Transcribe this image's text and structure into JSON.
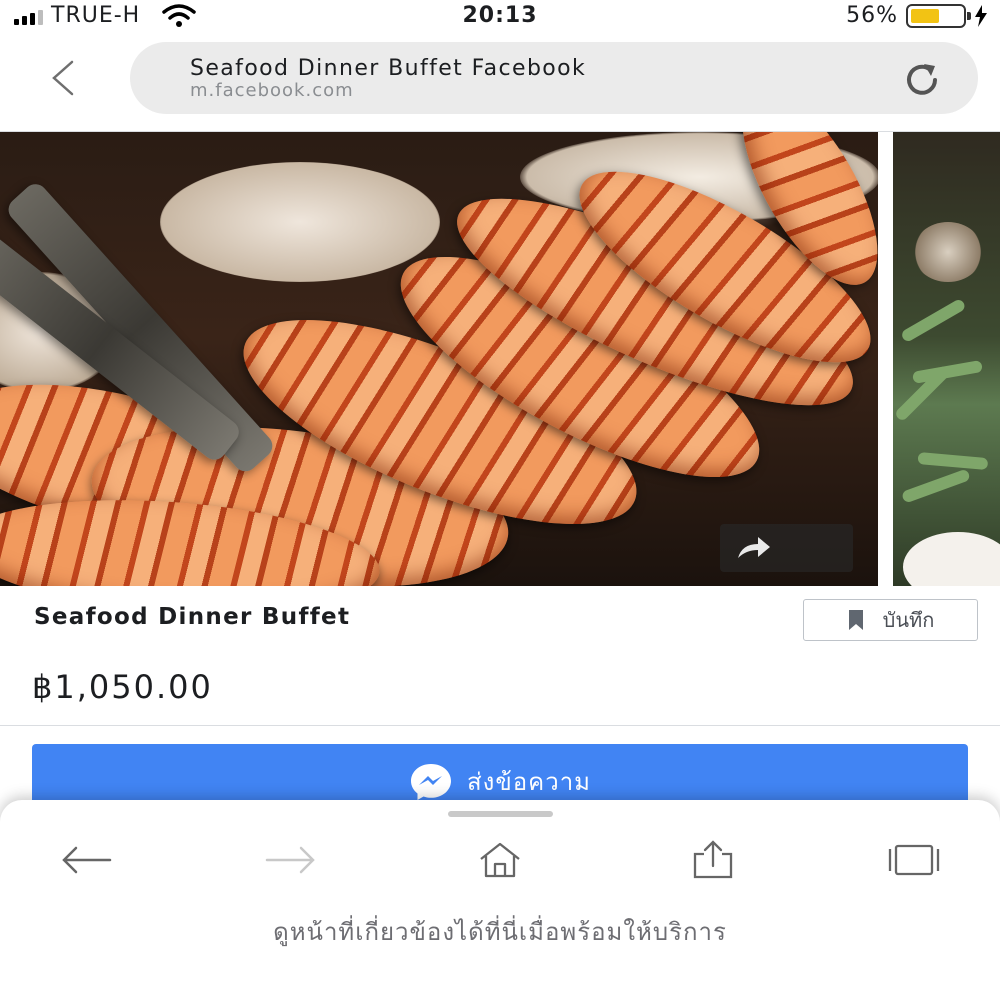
{
  "status_bar": {
    "carrier": "TRUE-H",
    "time": "20:13",
    "battery_percent_text": "56%",
    "battery_level": 0.56,
    "battery_color": "#f2c314"
  },
  "browser": {
    "page_title": "Seafood Dinner Buffet Facebook",
    "host": "m.facebook.com",
    "back_icon": "chevron-left-icon",
    "reload_icon": "reload-icon"
  },
  "gallery": {
    "share_icon": "share-arrow-icon"
  },
  "product": {
    "title": "Seafood Dinner Buffet",
    "save_label": "บันทึก",
    "save_icon": "bookmark-icon",
    "price": "฿1,050.00"
  },
  "message_button": {
    "label": "ส่งข้อความ",
    "icon": "messenger-icon",
    "color": "#4184f3"
  },
  "bottom_toolbar": {
    "icons": [
      "arrow-back-icon",
      "arrow-forward-icon",
      "home-icon",
      "share-icon",
      "tabs-icon"
    ],
    "related_text": "ดูหน้าที่เกี่ยวข้องได้ที่นี่เมื่อพร้อมให้บริการ"
  }
}
